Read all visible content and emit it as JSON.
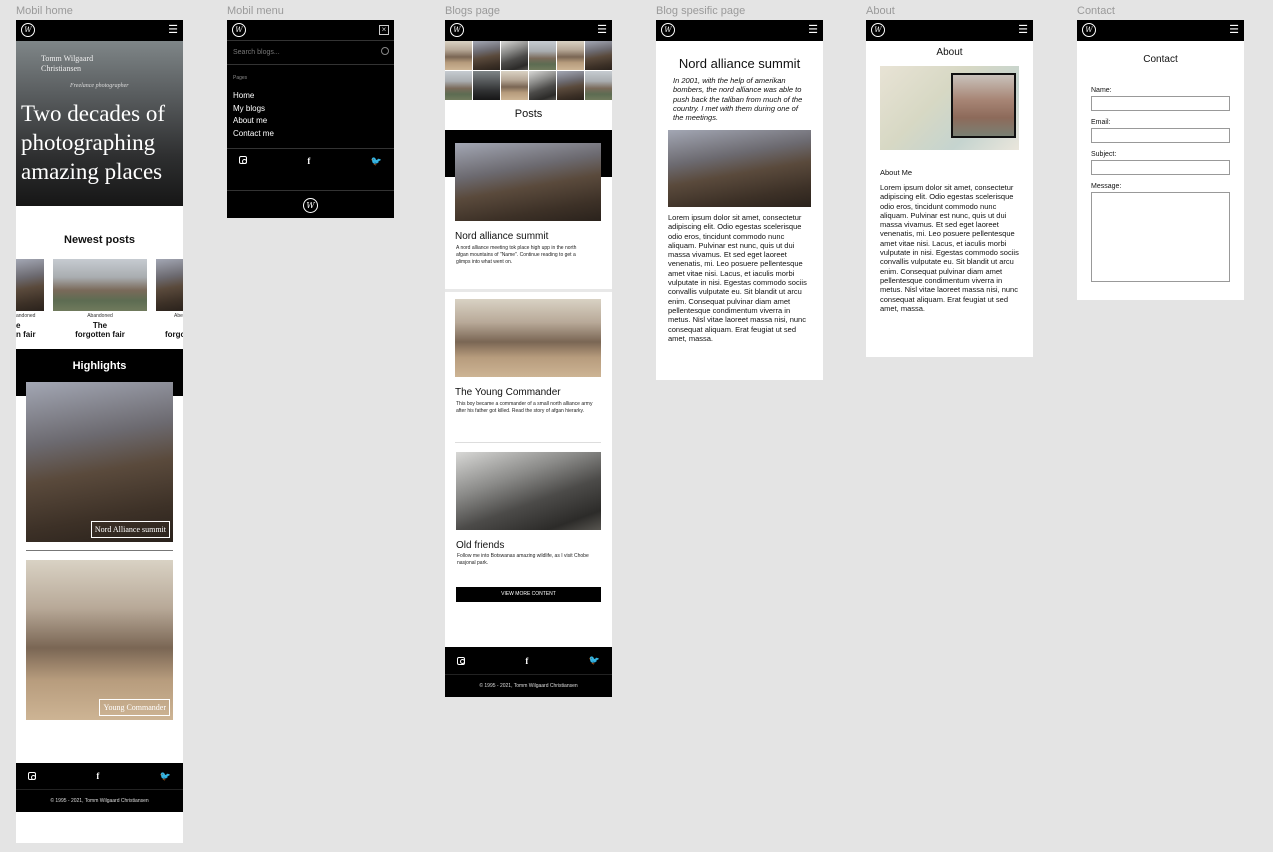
{
  "frames": {
    "home": "Mobil home",
    "menu": "Mobil menu",
    "blogs": "Blogs page",
    "blog_specific": "Blog spesific page",
    "about": "About",
    "contact": "Contact"
  },
  "common": {
    "logo": "W",
    "hamburger": "☰",
    "footer_copyright": "© 1995 - 2021, Tomm Wilgaard Christiansen",
    "footer_copyright_blogs": "© 1995 - 2021, Tomm Wilgaard Christiansen",
    "social": {
      "instagram": "instagram-icon",
      "facebook": "f",
      "twitter": "🐦"
    }
  },
  "home": {
    "hero_name_line1": "Tomm Wilgaard",
    "hero_name_line2": "Christiansen",
    "hero_sub": "Freelance photographer",
    "hero_title": "Two decades of photographing amazing places",
    "newest_posts": "Newest posts",
    "carousel": [
      {
        "category": "Abandoned",
        "title_l1": "The",
        "title_l2": "forgotten fair"
      }
    ],
    "left_partial": {
      "category": "andoned",
      "title_l1": "e",
      "title_l2": "n fair"
    },
    "right_partial": {
      "category": "Abe",
      "title_l1": "",
      "title_l2": "forgo"
    },
    "highlights": "Highlights",
    "highlight_items": [
      "Nord Alliance summit",
      "Young Commander"
    ]
  },
  "menu": {
    "search_placeholder": "Search blogs...",
    "pages_label": "Pages",
    "items": [
      "Home",
      "My blogs",
      "About me",
      "Contact me"
    ]
  },
  "blogs": {
    "posts_title": "Posts",
    "posts": [
      {
        "title": "Nord alliance summit",
        "body": "A nord alliance meeting tok place high upp in the north afgan mountains of \"Name\". Continue reading to get a glimps into what went on."
      },
      {
        "title": "The Young Commander",
        "body": "This boy became a commander of a small north alliance army after his father got killed. Read the story of afgan hierarky."
      },
      {
        "title": "Old friends",
        "body": "Follow me into Botswanas amazing wildlife, as I visit Chobe nasjonal park."
      }
    ],
    "view_more": "VIEW MORE CONTENT"
  },
  "blog_specific": {
    "title": "Nord alliance summit",
    "lead": "In 2001, with the help of amerikan bombers, the nord alliance was able to push back the taliban from much of the country. I met with them during one of the meetings.",
    "body": "Lorem ipsum dolor sit amet, consectetur adipiscing elit. Odio egestas scelerisque odio eros, tincidunt commodo nunc aliquam. Pulvinar est nunc, quis ut dui massa vivamus. Et sed eget laoreet venenatis, mi. Leo posuere pellentesque amet vitae nisi. Lacus, et iaculis morbi vulputate in nisi. Egestas commodo sociis convallis vulputate eu. Sit blandit ut arcu enim. Consequat pulvinar diam amet pellentesque condimentum viverra in metus. Nisl vitae laoreet massa nisi, nunc consequat aliquam. Erat feugiat ut sed amet, massa."
  },
  "about": {
    "title": "About",
    "subtitle": "About Me",
    "body": "Lorem ipsum dolor sit amet, consectetur adipiscing elit. Odio egestas scelerisque odio eros, tincidunt commodo nunc aliquam. Pulvinar est nunc, quis ut dui massa vivamus. Et sed eget laoreet venenatis, mi. Leo posuere pellentesque amet vitae nisi. Lacus, et iaculis morbi vulputate in nisi. Egestas commodo sociis convallis vulputate eu. Sit blandit ut arcu enim. Consequat pulvinar diam amet pellentesque condimentum viverra in metus. Nisl vitae laoreet massa nisi, nunc consequat aliquam. Erat feugiat ut sed amet, massa."
  },
  "contact": {
    "title": "Contact",
    "name_label": "Name:",
    "email_label": "Email:",
    "subject_label": "Subject:",
    "message_label": "Message:"
  }
}
